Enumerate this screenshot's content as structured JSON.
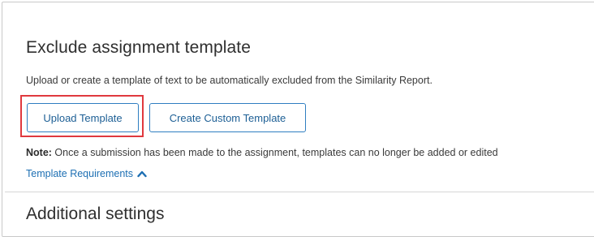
{
  "section": {
    "title": "Exclude assignment template",
    "description": "Upload or create a template of text to be automatically excluded from the Similarity Report."
  },
  "buttons": {
    "upload_label": "Upload Template",
    "create_label": "Create Custom Template"
  },
  "note": {
    "label": "Note:",
    "text": " Once a submission has been made to the assignment, templates can no longer be added or edited"
  },
  "requirements": {
    "link_label": "Template Requirements",
    "icon": "chevron-up-icon"
  },
  "next_section": {
    "title": "Additional settings"
  },
  "colors": {
    "accent_border": "#2f7ec1",
    "accent_text": "#1d5f95",
    "link": "#1d6fb3",
    "highlight": "#e0393e"
  }
}
